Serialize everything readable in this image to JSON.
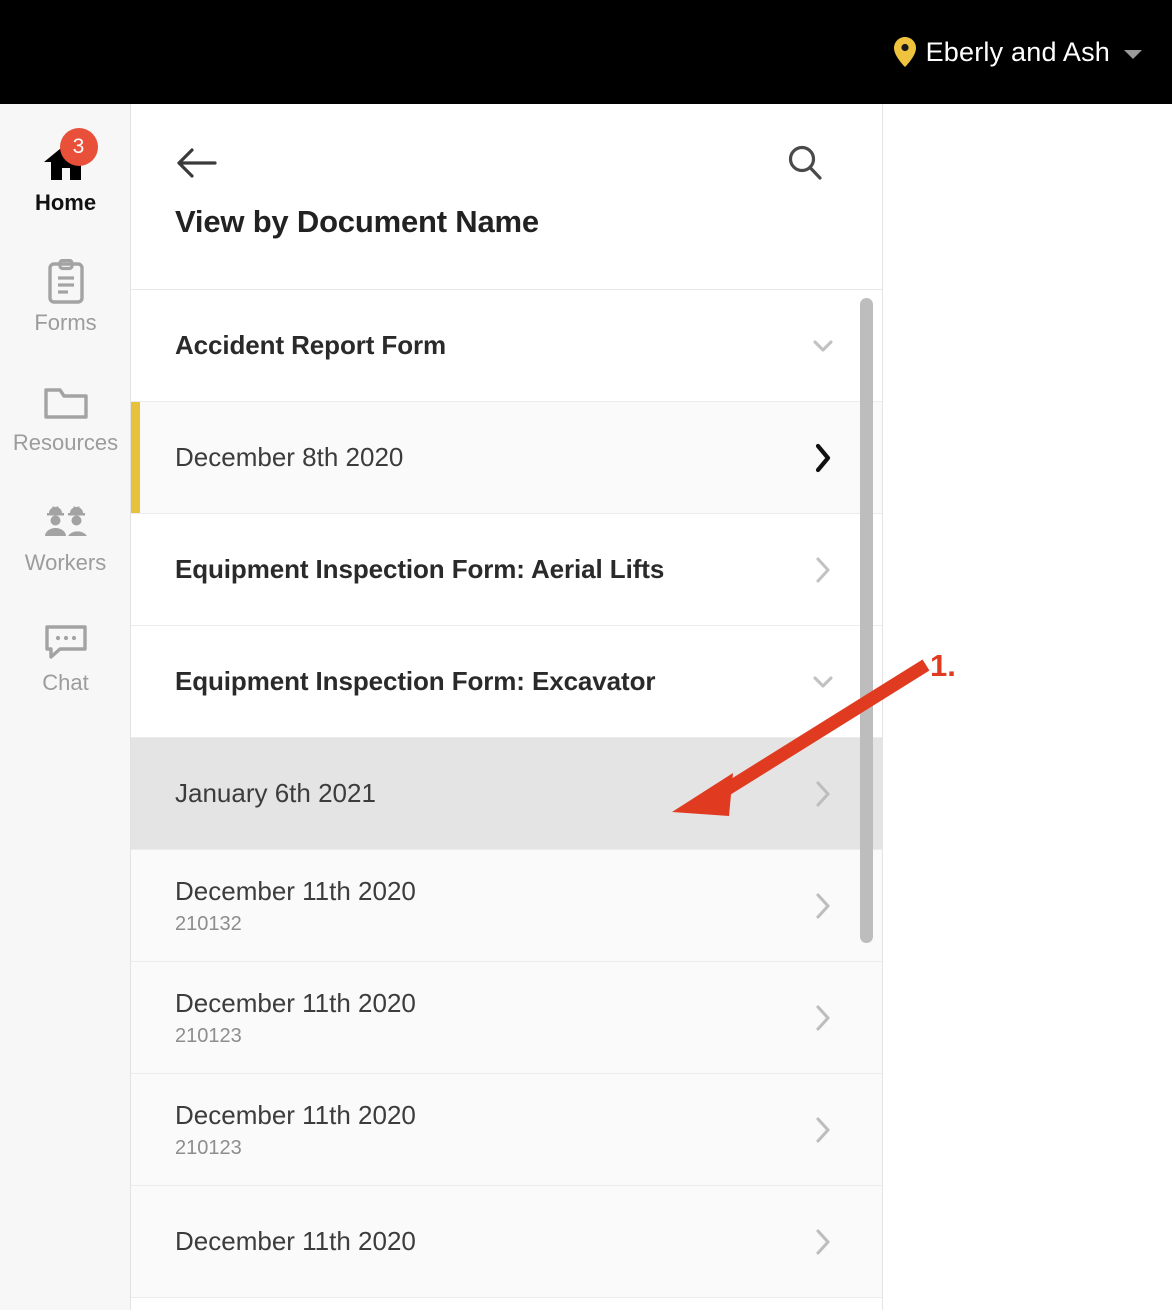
{
  "topbar": {
    "site_name": "Eberly and Ash",
    "pin_icon": "location-pin-icon",
    "caret_icon": "chevron-down-icon",
    "pin_color": "#efc33d",
    "background": "#000000"
  },
  "sidebar": {
    "items": [
      {
        "label": "Home",
        "icon": "home-icon",
        "active": true,
        "badge": "3"
      },
      {
        "label": "Forms",
        "icon": "clipboard-icon",
        "active": false,
        "badge": ""
      },
      {
        "label": "Resources",
        "icon": "folder-icon",
        "active": false,
        "badge": ""
      },
      {
        "label": "Workers",
        "icon": "workers-icon",
        "active": false,
        "badge": ""
      },
      {
        "label": "Chat",
        "icon": "chat-icon",
        "active": false,
        "badge": ""
      }
    ],
    "badge_color": "#e8503a"
  },
  "panel": {
    "back_icon": "back-arrow-icon",
    "search_icon": "search-icon",
    "title": "View by Document Name"
  },
  "list": {
    "accent_color": "#e8c13c",
    "rows": [
      {
        "kind": "group",
        "title": "Accident Report Form",
        "sub": "",
        "chevron": "chevron-down-icon",
        "accent": false,
        "highlight": false,
        "chevron_strong": false
      },
      {
        "kind": "child",
        "title": "December 8th 2020",
        "sub": "",
        "chevron": "chevron-right-icon",
        "accent": true,
        "highlight": false,
        "chevron_strong": true
      },
      {
        "kind": "group",
        "title": "Equipment Inspection Form: Aerial Lifts",
        "sub": "",
        "chevron": "chevron-right-icon",
        "accent": false,
        "highlight": false,
        "chevron_strong": false
      },
      {
        "kind": "group",
        "title": "Equipment Inspection Form: Excavator",
        "sub": "",
        "chevron": "chevron-down-icon",
        "accent": false,
        "highlight": false,
        "chevron_strong": false
      },
      {
        "kind": "child",
        "title": "January 6th 2021",
        "sub": "",
        "chevron": "chevron-right-icon",
        "accent": false,
        "highlight": true,
        "chevron_strong": false
      },
      {
        "kind": "child",
        "title": "December 11th 2020",
        "sub": "210132",
        "chevron": "chevron-right-icon",
        "accent": false,
        "highlight": false,
        "chevron_strong": false
      },
      {
        "kind": "child",
        "title": "December 11th 2020",
        "sub": "210123",
        "chevron": "chevron-right-icon",
        "accent": false,
        "highlight": false,
        "chevron_strong": false
      },
      {
        "kind": "child",
        "title": "December 11th 2020",
        "sub": "210123",
        "chevron": "chevron-right-icon",
        "accent": false,
        "highlight": false,
        "chevron_strong": false
      },
      {
        "kind": "child",
        "title": "December 11th 2020",
        "sub": "",
        "chevron": "chevron-right-icon",
        "accent": false,
        "highlight": false,
        "chevron_strong": false
      }
    ]
  },
  "annotation": {
    "label": "1.",
    "color": "#e03b21"
  }
}
